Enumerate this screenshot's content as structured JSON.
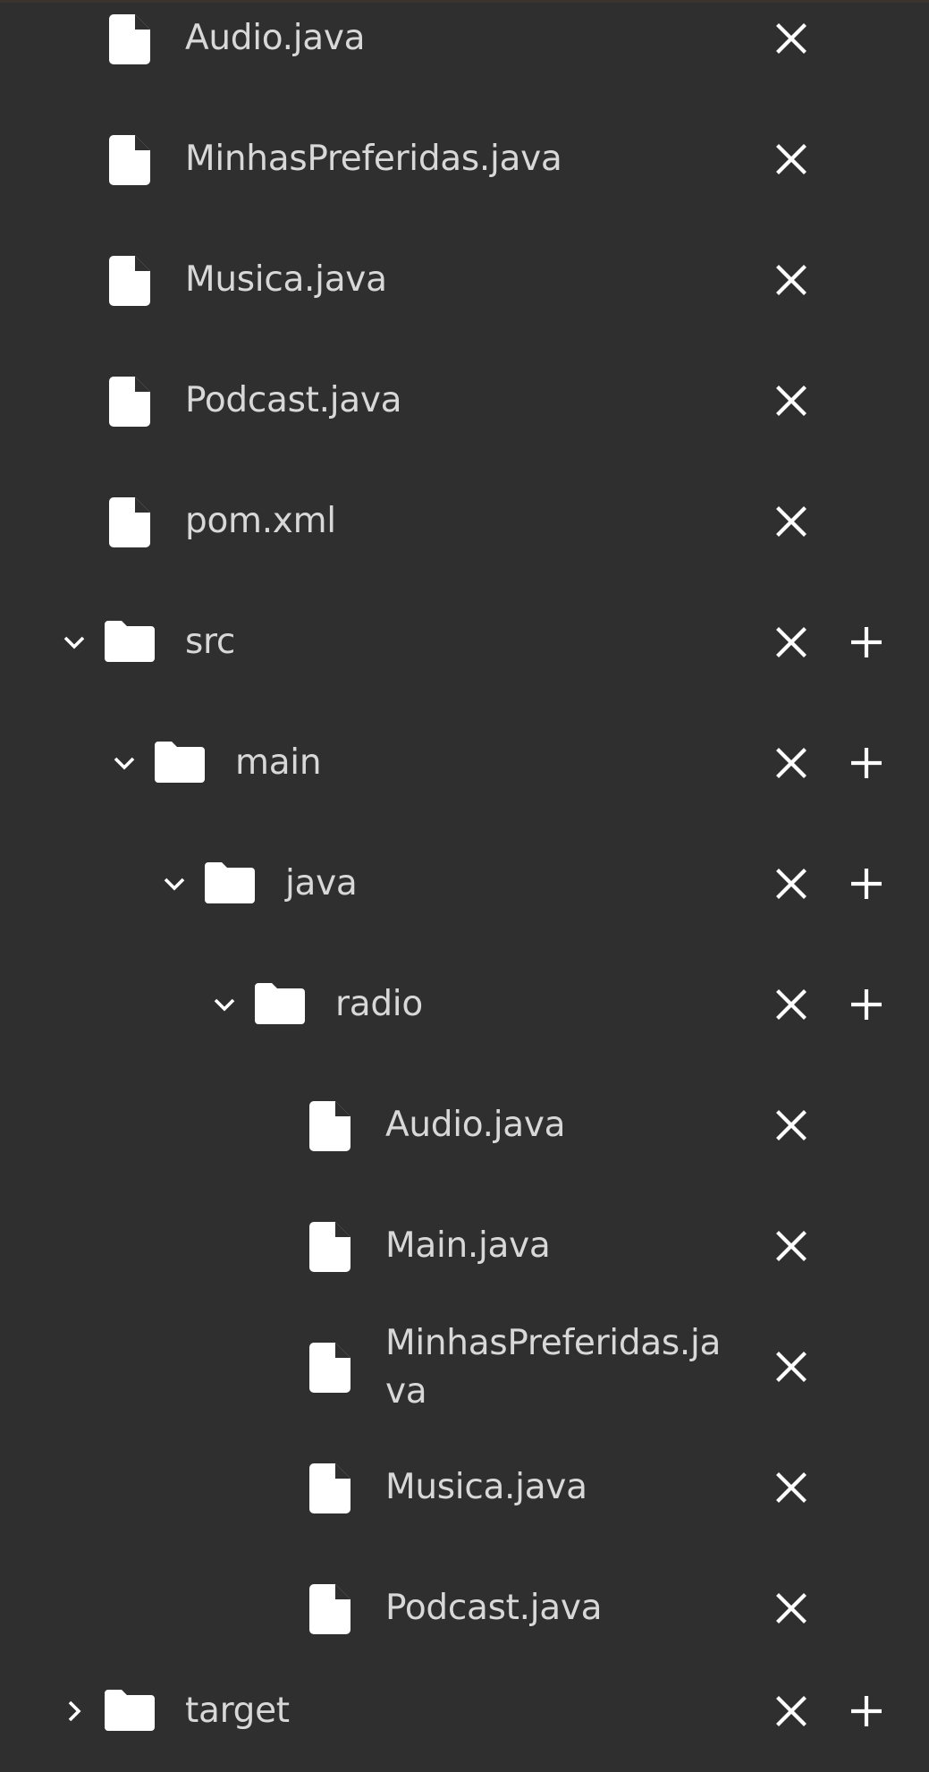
{
  "tree": {
    "items": [
      {
        "label": "Audio.java",
        "type": "file",
        "icon": "file-icon",
        "actions": [
          "close-icon"
        ]
      },
      {
        "label": "MinhasPreferidas.java",
        "type": "file",
        "icon": "file-icon",
        "actions": [
          "close-icon"
        ]
      },
      {
        "label": "Musica.java",
        "type": "file",
        "icon": "file-icon",
        "actions": [
          "close-icon"
        ]
      },
      {
        "label": "Podcast.java",
        "type": "file",
        "icon": "file-icon",
        "actions": [
          "close-icon"
        ]
      },
      {
        "label": "pom.xml",
        "type": "file",
        "icon": "file-icon",
        "actions": [
          "close-icon"
        ]
      },
      {
        "label": "src",
        "type": "folder",
        "expanded": true,
        "icon": "folder-icon",
        "actions": [
          "close-icon",
          "plus-icon"
        ]
      },
      {
        "label": "main",
        "type": "folder",
        "expanded": true,
        "icon": "folder-icon",
        "actions": [
          "close-icon",
          "plus-icon"
        ]
      },
      {
        "label": "java",
        "type": "folder",
        "expanded": true,
        "icon": "folder-icon",
        "actions": [
          "close-icon",
          "plus-icon"
        ]
      },
      {
        "label": "radio",
        "type": "folder",
        "expanded": true,
        "icon": "folder-icon",
        "actions": [
          "close-icon",
          "plus-icon"
        ]
      },
      {
        "label": "Audio.java",
        "type": "file",
        "icon": "file-icon",
        "actions": [
          "close-icon"
        ]
      },
      {
        "label": "Main.java",
        "type": "file",
        "icon": "file-icon",
        "actions": [
          "close-icon"
        ]
      },
      {
        "label": "MinhasPreferidas.java",
        "type": "file",
        "icon": "file-icon",
        "actions": [
          "close-icon"
        ]
      },
      {
        "label": "Musica.java",
        "type": "file",
        "icon": "file-icon",
        "actions": [
          "close-icon"
        ]
      },
      {
        "label": "Podcast.java",
        "type": "file",
        "icon": "file-icon",
        "actions": [
          "close-icon"
        ]
      },
      {
        "label": "target",
        "type": "folder",
        "expanded": false,
        "icon": "folder-icon",
        "actions": [
          "close-icon",
          "plus-icon"
        ]
      }
    ]
  },
  "colors": {
    "background": "#2f2f2f",
    "icon": "#ffffff",
    "text": "#d8d8d8"
  }
}
